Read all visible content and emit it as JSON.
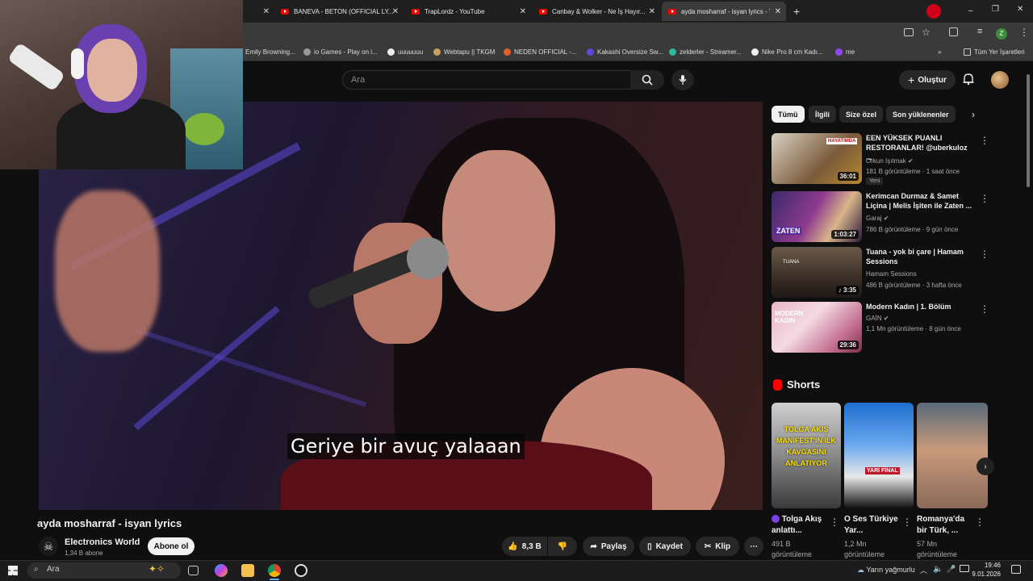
{
  "browser": {
    "tabs": [
      {
        "label": "BANEVA - BETON (OFFICIAL LY...",
        "active": false
      },
      {
        "label": "TrapLordz - YouTube",
        "active": false
      },
      {
        "label": "Canbay & Wolker - Ne İş Hayır...",
        "active": false
      },
      {
        "label": "ayda mosharraf - isyan lyrics - Y",
        "active": true
      }
    ],
    "new_tab": "+",
    "bookmarks": [
      "Emily Browning...",
      "io Games - Play on i...",
      "uuuuuuu",
      "Webtapu || TKGM",
      "NEDEN OFFICIAL -...",
      "Kakashi Oversize Sw...",
      "zelderler - Streamer...",
      "Nike Pro 8 cm Kadı...",
      "me"
    ],
    "all_bookmarks": "Tüm Yer İşaretleri",
    "profile_letter": "Z"
  },
  "youtube": {
    "search_placeholder": "Ara",
    "create_label": "Oluştur",
    "video": {
      "caption": "Geriye bir avuç yalaaan",
      "title": "ayda mosharraf - isyan lyrics",
      "channel": "Electronics World",
      "subscribers": "1,34 B abone",
      "subscribe_label": "Abone ol",
      "likes": "8,3 B",
      "share_label": "Paylaş",
      "save_label": "Kaydet",
      "clip_label": "Klip"
    },
    "chips": [
      "Tümü",
      "İlgili",
      "Size özel",
      "Son yüklenenler"
    ],
    "recommendations": [
      {
        "title": "EEN YÜKSEK PUANLI RESTORANLAR! @uberkuloz ...",
        "channel": "Orkun Işıtmak",
        "meta": "181 B görüntüleme · 1 saat önce",
        "duration": "36:01",
        "badge": "Yeni",
        "thumb_text": "HAYATIMDA"
      },
      {
        "title": "Kerimcan Durmaz & Samet Liçina | Melis İşiten ile Zaten ...",
        "channel": "Garaj",
        "meta": "786 B görüntüleme · 9 gün önce",
        "duration": "1:03:27",
        "badge": "",
        "thumb_text": "ZATEN"
      },
      {
        "title": "Tuana - yok bi çare | Hamam Sessions",
        "channel": "Hamam Sessions",
        "meta": "486 B görüntüleme · 3 hafta önce",
        "duration": "♪ 3:35",
        "badge": "",
        "thumb_text": "TUANA"
      },
      {
        "title": "Modern Kadın | 1. Bölüm",
        "channel": "GAİN",
        "meta": "1,1 Mn görüntüleme · 8 gün önce",
        "duration": "29:36",
        "badge": "",
        "thumb_text": "MODERN KADIN"
      }
    ],
    "shorts_heading": "Shorts",
    "shorts": [
      {
        "title": "Tolga Akış anlattı...",
        "views": "491 B görüntüleme",
        "overlay": "TOLGA AKIŞ MANİFEST'İN İLK KAVGASINI ANLATIYOR"
      },
      {
        "title": "O Ses Türkiye Yar...",
        "views": "1,2 Mn görüntüleme",
        "overlay": "YARI FİNAL"
      },
      {
        "title": "Romanya'da bir Türk, ...",
        "views": "57 Mn görüntüleme",
        "overlay": ""
      }
    ]
  },
  "taskbar": {
    "search_placeholder": "Ara",
    "weather": "Yarın yağmurlu",
    "time": "19:46",
    "date": "9.01.2026"
  },
  "colors": {
    "background": "#0f0f0f",
    "youtube_red": "#ff0000",
    "chip_bg": "#272727",
    "text": "#f1f1f1",
    "muted": "#aaaaaa"
  }
}
